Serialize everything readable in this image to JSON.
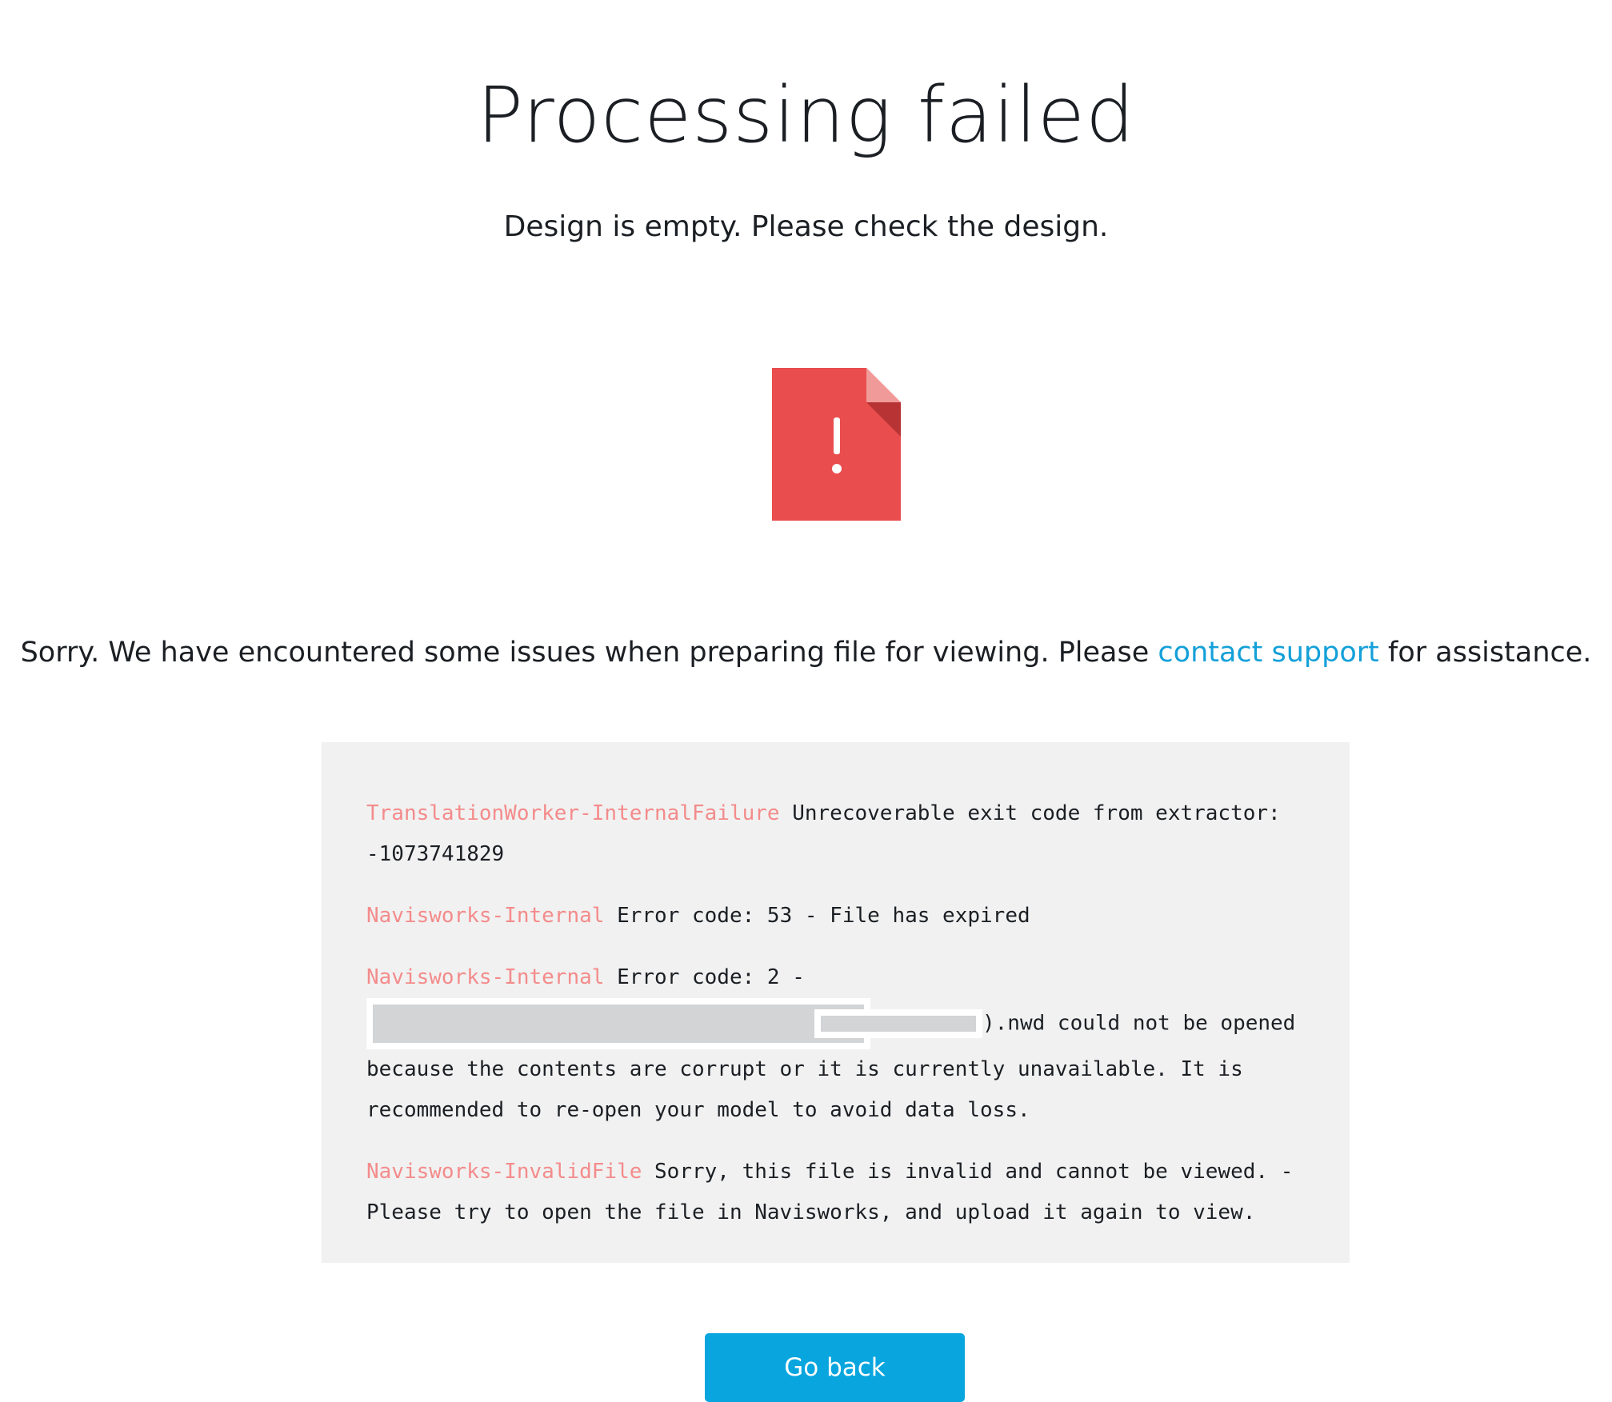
{
  "header": {
    "title": "Processing failed",
    "subtitle": "Design is empty. Please check the design."
  },
  "icon": {
    "name": "file-error-icon",
    "color": "#e94d4d",
    "fold_color": "#b83434",
    "fold_light_color": "#f19a9a"
  },
  "message": {
    "before_link": "Sorry. We have encountered some issues when preparing file for viewing. Please ",
    "link_text": "contact support",
    "after_link": " for assistance."
  },
  "errors": [
    {
      "code": "TranslationWorker-InternalFailure",
      "text": " Unrecoverable exit code from extractor: -1073741829"
    },
    {
      "code": "Navisworks-Internal",
      "text": " Error code: 53 - File has expired"
    },
    {
      "code": "Navisworks-Internal",
      "text_before": " Error code: 2 - ",
      "text_after": ").nwd could not be opened because the contents are corrupt or it is currently unavailable. It is recommended to re-open your model to avoid data loss."
    },
    {
      "code": "Navisworks-InvalidFile",
      "text": " Sorry, this file is invalid and cannot be viewed. - Please try to open the file in Navisworks, and upload it again to view."
    }
  ],
  "actions": {
    "go_back_label": "Go back"
  },
  "colors": {
    "accent": "#08a5de",
    "link": "#14a0d9",
    "error_code": "#f48b8b",
    "box_background": "#f1f1f1"
  }
}
